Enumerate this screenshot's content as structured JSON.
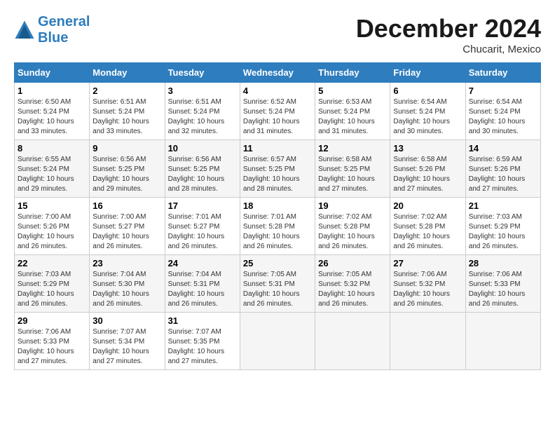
{
  "header": {
    "logo_line1": "General",
    "logo_line2": "Blue",
    "month_title": "December 2024",
    "location": "Chucarit, Mexico"
  },
  "weekdays": [
    "Sunday",
    "Monday",
    "Tuesday",
    "Wednesday",
    "Thursday",
    "Friday",
    "Saturday"
  ],
  "weeks": [
    [
      {
        "day": "1",
        "info": "Sunrise: 6:50 AM\nSunset: 5:24 PM\nDaylight: 10 hours\nand 33 minutes."
      },
      {
        "day": "2",
        "info": "Sunrise: 6:51 AM\nSunset: 5:24 PM\nDaylight: 10 hours\nand 33 minutes."
      },
      {
        "day": "3",
        "info": "Sunrise: 6:51 AM\nSunset: 5:24 PM\nDaylight: 10 hours\nand 32 minutes."
      },
      {
        "day": "4",
        "info": "Sunrise: 6:52 AM\nSunset: 5:24 PM\nDaylight: 10 hours\nand 31 minutes."
      },
      {
        "day": "5",
        "info": "Sunrise: 6:53 AM\nSunset: 5:24 PM\nDaylight: 10 hours\nand 31 minutes."
      },
      {
        "day": "6",
        "info": "Sunrise: 6:54 AM\nSunset: 5:24 PM\nDaylight: 10 hours\nand 30 minutes."
      },
      {
        "day": "7",
        "info": "Sunrise: 6:54 AM\nSunset: 5:24 PM\nDaylight: 10 hours\nand 30 minutes."
      }
    ],
    [
      {
        "day": "8",
        "info": "Sunrise: 6:55 AM\nSunset: 5:24 PM\nDaylight: 10 hours\nand 29 minutes."
      },
      {
        "day": "9",
        "info": "Sunrise: 6:56 AM\nSunset: 5:25 PM\nDaylight: 10 hours\nand 29 minutes."
      },
      {
        "day": "10",
        "info": "Sunrise: 6:56 AM\nSunset: 5:25 PM\nDaylight: 10 hours\nand 28 minutes."
      },
      {
        "day": "11",
        "info": "Sunrise: 6:57 AM\nSunset: 5:25 PM\nDaylight: 10 hours\nand 28 minutes."
      },
      {
        "day": "12",
        "info": "Sunrise: 6:58 AM\nSunset: 5:25 PM\nDaylight: 10 hours\nand 27 minutes."
      },
      {
        "day": "13",
        "info": "Sunrise: 6:58 AM\nSunset: 5:26 PM\nDaylight: 10 hours\nand 27 minutes."
      },
      {
        "day": "14",
        "info": "Sunrise: 6:59 AM\nSunset: 5:26 PM\nDaylight: 10 hours\nand 27 minutes."
      }
    ],
    [
      {
        "day": "15",
        "info": "Sunrise: 7:00 AM\nSunset: 5:26 PM\nDaylight: 10 hours\nand 26 minutes."
      },
      {
        "day": "16",
        "info": "Sunrise: 7:00 AM\nSunset: 5:27 PM\nDaylight: 10 hours\nand 26 minutes."
      },
      {
        "day": "17",
        "info": "Sunrise: 7:01 AM\nSunset: 5:27 PM\nDaylight: 10 hours\nand 26 minutes."
      },
      {
        "day": "18",
        "info": "Sunrise: 7:01 AM\nSunset: 5:28 PM\nDaylight: 10 hours\nand 26 minutes."
      },
      {
        "day": "19",
        "info": "Sunrise: 7:02 AM\nSunset: 5:28 PM\nDaylight: 10 hours\nand 26 minutes."
      },
      {
        "day": "20",
        "info": "Sunrise: 7:02 AM\nSunset: 5:28 PM\nDaylight: 10 hours\nand 26 minutes."
      },
      {
        "day": "21",
        "info": "Sunrise: 7:03 AM\nSunset: 5:29 PM\nDaylight: 10 hours\nand 26 minutes."
      }
    ],
    [
      {
        "day": "22",
        "info": "Sunrise: 7:03 AM\nSunset: 5:29 PM\nDaylight: 10 hours\nand 26 minutes."
      },
      {
        "day": "23",
        "info": "Sunrise: 7:04 AM\nSunset: 5:30 PM\nDaylight: 10 hours\nand 26 minutes."
      },
      {
        "day": "24",
        "info": "Sunrise: 7:04 AM\nSunset: 5:31 PM\nDaylight: 10 hours\nand 26 minutes."
      },
      {
        "day": "25",
        "info": "Sunrise: 7:05 AM\nSunset: 5:31 PM\nDaylight: 10 hours\nand 26 minutes."
      },
      {
        "day": "26",
        "info": "Sunrise: 7:05 AM\nSunset: 5:32 PM\nDaylight: 10 hours\nand 26 minutes."
      },
      {
        "day": "27",
        "info": "Sunrise: 7:06 AM\nSunset: 5:32 PM\nDaylight: 10 hours\nand 26 minutes."
      },
      {
        "day": "28",
        "info": "Sunrise: 7:06 AM\nSunset: 5:33 PM\nDaylight: 10 hours\nand 26 minutes."
      }
    ],
    [
      {
        "day": "29",
        "info": "Sunrise: 7:06 AM\nSunset: 5:33 PM\nDaylight: 10 hours\nand 27 minutes."
      },
      {
        "day": "30",
        "info": "Sunrise: 7:07 AM\nSunset: 5:34 PM\nDaylight: 10 hours\nand 27 minutes."
      },
      {
        "day": "31",
        "info": "Sunrise: 7:07 AM\nSunset: 5:35 PM\nDaylight: 10 hours\nand 27 minutes."
      },
      {
        "day": "",
        "info": ""
      },
      {
        "day": "",
        "info": ""
      },
      {
        "day": "",
        "info": ""
      },
      {
        "day": "",
        "info": ""
      }
    ]
  ]
}
